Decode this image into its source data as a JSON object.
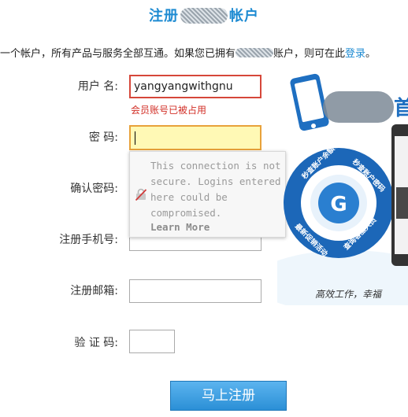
{
  "page": {
    "title_prefix": "注册",
    "title_suffix": "帐户",
    "intro_before": "一个帐户，所有产品与服务全部互通。如果您已拥有",
    "intro_after": "账户，则可在此",
    "login_link": "登录",
    "intro_end": "。"
  },
  "form": {
    "username_label": "用户 名:",
    "username_value": "yangyangwithgnu",
    "username_error": "会员账号已被占用",
    "password_label": "密  码:",
    "confirm_label": "确认密码:",
    "phone_label": "注册手机号:",
    "email_label": "注册邮箱:",
    "captcha_label": "验 证 码:",
    "submit_label": "马上注册"
  },
  "tooltip": {
    "message": "This connection is not secure. Logins entered here could be compromised.",
    "learn_more": "Learn More"
  },
  "promo": {
    "headline_partial": "首",
    "ring_items": [
      "秒查账户余额",
      "秒查账户密码",
      "查询客服人员",
      "最新促销活动"
    ],
    "center_logo": "G",
    "tagline": "高效工作，幸福"
  },
  "colors": {
    "accent": "#1e8bd2",
    "error": "#d22f27",
    "warning_border": "#e8a23b",
    "autofill_bg": "#fff9b5"
  }
}
